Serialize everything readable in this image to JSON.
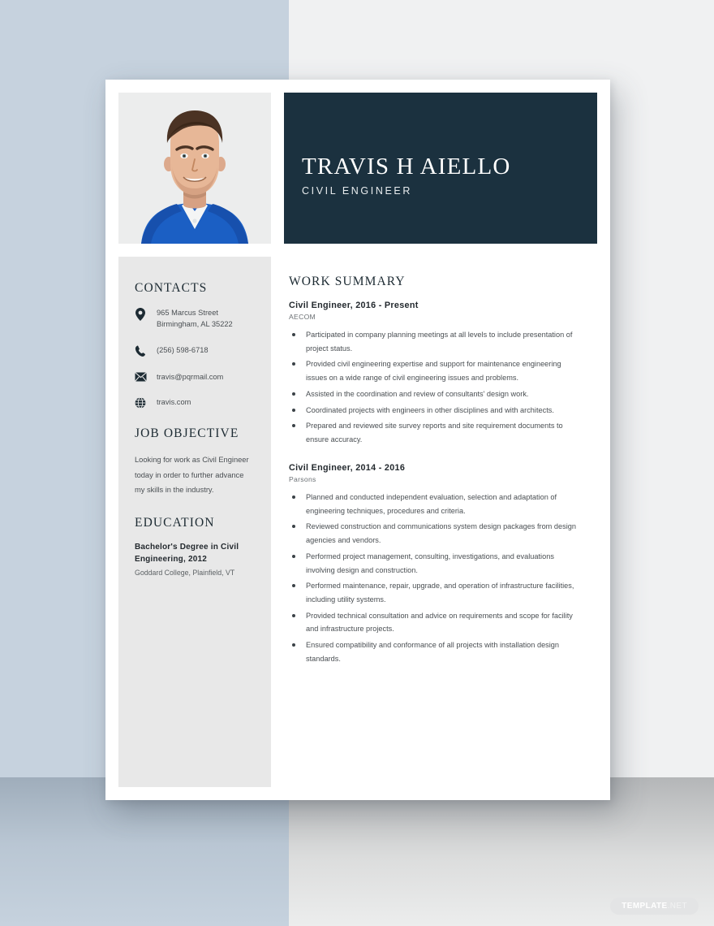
{
  "header": {
    "name": "TRAVIS H AIELLO",
    "role": "CIVIL ENGINEER"
  },
  "photo": {
    "alt": "portrait-photo",
    "shirt_color": "#1b5fc4",
    "background": "#eceded"
  },
  "sidebar": {
    "contacts": {
      "heading": "CONTACTS",
      "items": [
        {
          "icon": "location-pin-icon",
          "text": "965 Marcus Street\nBirmingham, AL 35222"
        },
        {
          "icon": "phone-icon",
          "text": "(256) 598-6718"
        },
        {
          "icon": "envelope-icon",
          "text": "travis@pqrmail.com"
        },
        {
          "icon": "globe-icon",
          "text": "travis.com"
        }
      ]
    },
    "objective": {
      "heading": "JOB OBJECTIVE",
      "text": "Looking for work as Civil Engineer today in order to further advance my skills in the industry."
    },
    "education": {
      "heading": "EDUCATION",
      "degree": "Bachelor's Degree in Civil Engineering, 2012",
      "school": "Goddard College, Plainfield, VT"
    }
  },
  "main": {
    "heading": "WORK SUMMARY",
    "jobs": [
      {
        "title": "Civil Engineer, 2016 - Present",
        "company": "AECOM",
        "bullets": [
          "Participated in company planning meetings at all levels to include presentation of project status.",
          "Provided civil engineering expertise and support for maintenance engineering issues on a wide range of civil engineering issues and problems.",
          "Assisted in the coordination and review of consultants' design work.",
          "Coordinated projects with engineers in other disciplines and with architects.",
          "Prepared and reviewed site survey reports and site requirement documents to ensure accuracy."
        ]
      },
      {
        "title": "Civil Engineer, 2014 - 2016",
        "company": "Parsons",
        "bullets": [
          "Planned and conducted independent evaluation, selection and adaptation of engineering techniques, procedures and criteria.",
          "Reviewed construction and communications system design packages from design agencies and vendors.",
          "Performed project management, consulting, investigations, and evaluations involving design and construction.",
          "Performed maintenance, repair, upgrade, and operation of infrastructure facilities, including utility systems.",
          "Provided technical consultation and advice on requirements and scope for facility and infrastructure projects.",
          "Ensured compatibility and conformance of all projects with installation design standards."
        ]
      }
    ]
  },
  "watermark": {
    "brand": "TEMPLATE",
    "tld": ".NET"
  },
  "colors": {
    "header_navy": "#1b313f",
    "sidebar_gray": "#e8e8e8",
    "backdrop_blue": "#c6d2de",
    "backdrop_gray": "#f0f1f2"
  }
}
